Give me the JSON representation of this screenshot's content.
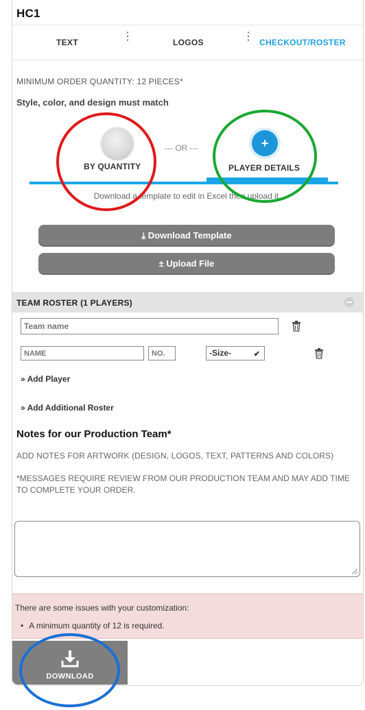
{
  "product": {
    "title": "HC1"
  },
  "tabs": [
    {
      "label": "TEXT",
      "active": false
    },
    {
      "label": "LOGOS",
      "active": false
    },
    {
      "label": "CHECKOUT/ROSTER",
      "active": true
    }
  ],
  "checkout": {
    "min_order": "MINIMUM ORDER QUANTITY: 12 PIECES*",
    "style_note": "Style, color, and design must match",
    "option_quantity": "BY QUANTITY",
    "option_separator": "--- OR ---",
    "option_player": "PLAYER DETAILS",
    "option_player_glyph": "+",
    "template_text": "Download a template to edit in Excel then upload it.",
    "download_template_label": "⤓ Download Template",
    "upload_file_label": "± Upload File"
  },
  "roster": {
    "header": "TEAM ROSTER (1 PLAYERS)",
    "team_name_placeholder": "Team name",
    "player": {
      "name_placeholder": "NAME",
      "number_placeholder": "NO.",
      "size_value": "-Size-",
      "size_arrow": "✔"
    },
    "add_player": "» Add Player",
    "add_roster": "» Add Additional Roster"
  },
  "notes": {
    "title": "Notes for our Production Team*",
    "hint": "ADD NOTES FOR ARTWORK (DESIGN, LOGOS, TEXT, PATTERNS AND COLORS)",
    "message": "*MESSAGES REQUIRE REVIEW FROM OUR PRODUCTION TEAM AND MAY ADD TIME TO COMPLETE YOUR ORDER.",
    "value": ""
  },
  "issues": {
    "title": "There are some issues with your customization:",
    "items": [
      "A minimum quantity of 12 is required."
    ]
  },
  "footer": {
    "download_label": "DOWNLOAD"
  },
  "annotation_colors": {
    "red": "#e01919",
    "green": "#1aa832",
    "blue": "#1a6fd6"
  },
  "colors": {
    "accent": "#1f9fe0",
    "button_grey": "#7d7d7d",
    "error_bg": "#f4dcdc"
  }
}
